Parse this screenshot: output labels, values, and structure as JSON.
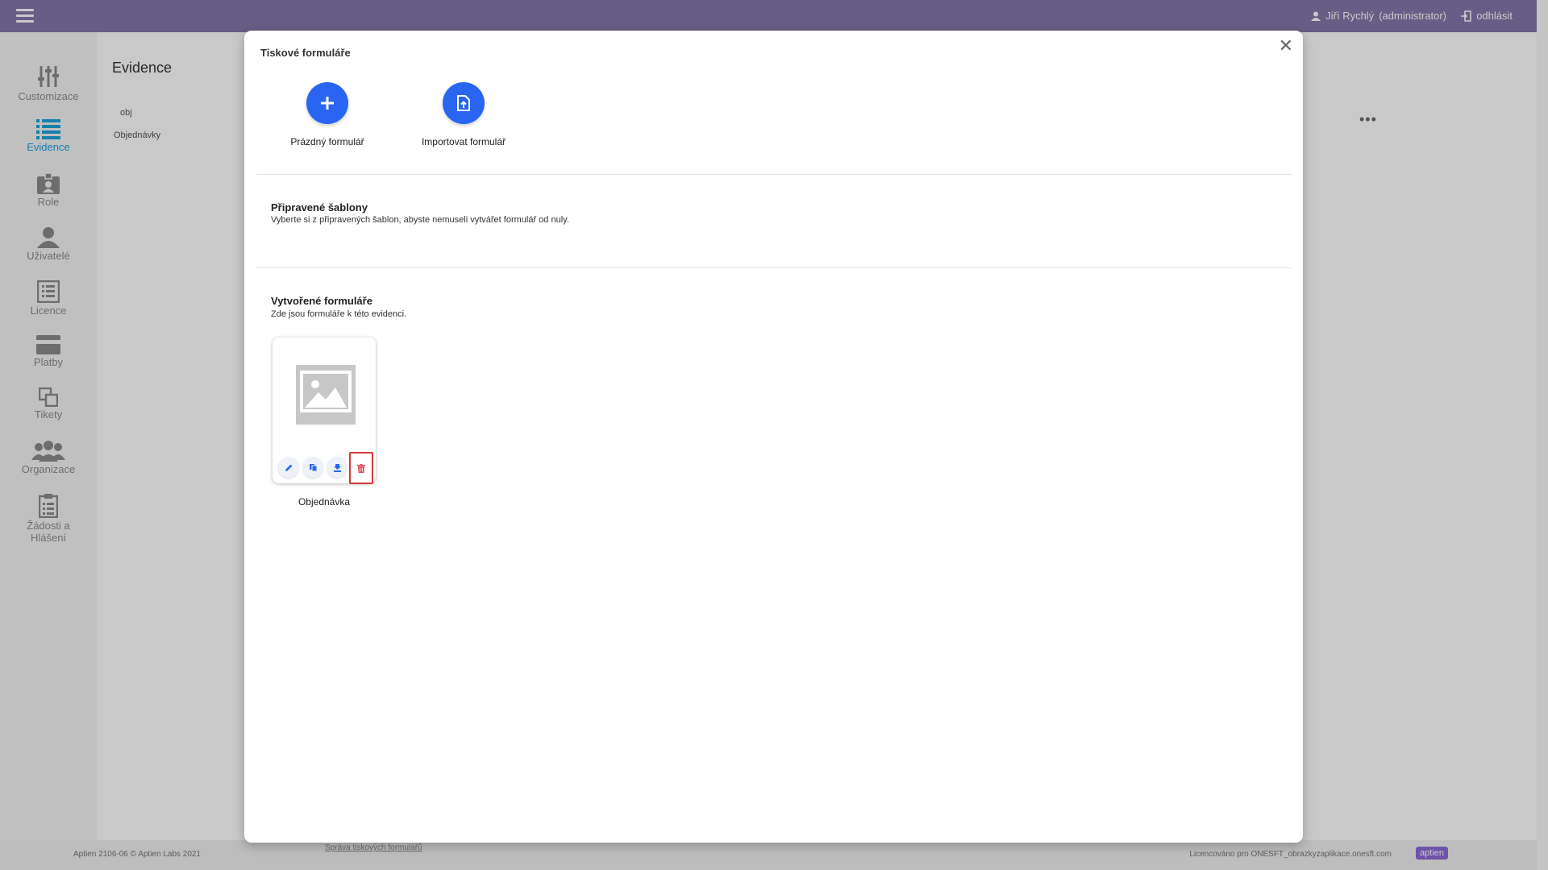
{
  "header": {
    "user": "Jiří Rychlý",
    "role": "(administrator)",
    "logout": "odhlásit"
  },
  "sidebar": {
    "items": [
      {
        "label": "Customizace",
        "icon": "sliders-icon"
      },
      {
        "label": "Evidence",
        "icon": "list-icon",
        "active": true
      },
      {
        "label": "Role",
        "icon": "id-badge-icon"
      },
      {
        "label": "Uživatelé",
        "icon": "user-icon"
      },
      {
        "label": "Licence",
        "icon": "document-list-icon"
      },
      {
        "label": "Platby",
        "icon": "credit-card-icon"
      },
      {
        "label": "Tikety",
        "icon": "copy-icon"
      },
      {
        "label": "Organizace",
        "icon": "group-icon"
      },
      {
        "label": "Žádosti a Hlášení",
        "icon": "clipboard-icon"
      }
    ]
  },
  "panel": {
    "title": "Evidence",
    "item_code": "obj",
    "item_name": "Objednávky"
  },
  "modal": {
    "title": "Tiskové formuláře",
    "actions": [
      {
        "label": "Prázdný formulář",
        "icon": "plus-icon"
      },
      {
        "label": "Importovat formulář",
        "icon": "file-upload-icon"
      }
    ],
    "templates": {
      "title": "Připravené šablony",
      "subtitle": "Vyberte si z připravených šablon, abyste nemuseli vytvářet formulář od nuly."
    },
    "created": {
      "title": "Vytvořené formuláře",
      "subtitle": "Zde jsou formuláře k této evidenci.",
      "forms": [
        {
          "name": "Objednávka",
          "tools": [
            "edit-icon",
            "copy-icon",
            "download-icon",
            "delete-icon"
          ]
        }
      ]
    }
  },
  "footer": {
    "version": "Aptien 2106-06 © Aptien Labs 2021",
    "link": "Správa tiskových formulářů",
    "license": "Licencováno pro ONESFT_obrazkyzaplikace.onesft.com",
    "brand": "aptien"
  },
  "colors": {
    "topbar": "#8577ab",
    "accent": "#2965f1",
    "active_nav": "#1aa3d9",
    "danger": "#d43a3a"
  }
}
